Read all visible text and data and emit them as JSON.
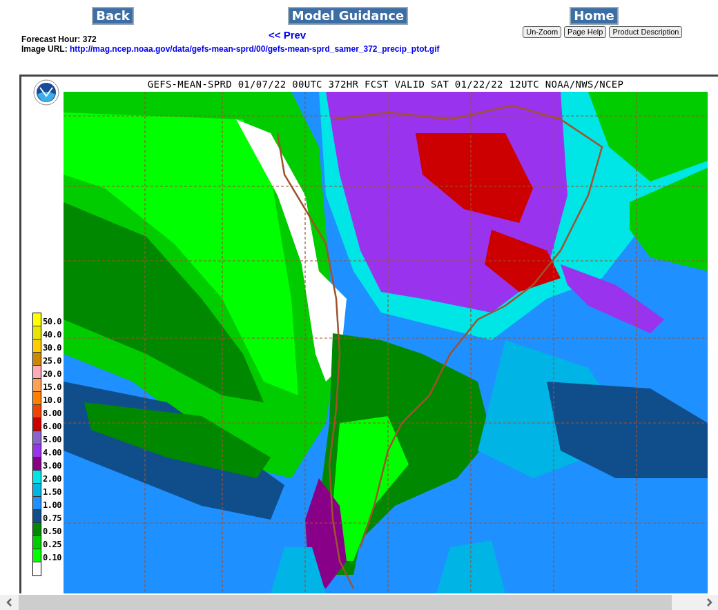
{
  "nav_buttons": [
    "Back",
    "Model Guidance",
    "Home"
  ],
  "prev_link": "<< Prev",
  "tool_buttons": [
    "Un-Zoom",
    "Page Help",
    "Product Description"
  ],
  "forecast_hour": {
    "label": "Forecast Hour:",
    "value": "372"
  },
  "image_url": {
    "label": "Image URL:",
    "value": "http://mag.ncep.noaa.gov/data/gefs-mean-sprd/00/gefs-mean-sprd_samer_372_precip_ptot.gif"
  },
  "map": {
    "title": "GEFS-MEAN-SPRD 01/07/22 00UTC 372HR FCST VALID SAT 01/22/22 12UTC NOAA/NWS/NCEP",
    "legend": [
      {
        "label": "50.0",
        "color": "#ffff00"
      },
      {
        "label": "40.0",
        "color": "#e6e600"
      },
      {
        "label": "30.0",
        "color": "#ffcc00"
      },
      {
        "label": "25.0",
        "color": "#cc8800"
      },
      {
        "label": "20.0",
        "color": "#ffaab4"
      },
      {
        "label": "15.0",
        "color": "#ffa050"
      },
      {
        "label": "10.0",
        "color": "#ff7f00"
      },
      {
        "label": "8.00",
        "color": "#ee4400"
      },
      {
        "label": "6.00",
        "color": "#cc0000"
      },
      {
        "label": "5.00",
        "color": "#8866cc"
      },
      {
        "label": "4.00",
        "color": "#9933ee"
      },
      {
        "label": "3.00",
        "color": "#880088"
      },
      {
        "label": "2.00",
        "color": "#00e5e5"
      },
      {
        "label": "1.50",
        "color": "#00b4e6"
      },
      {
        "label": "1.00",
        "color": "#1e90ff"
      },
      {
        "label": "0.75",
        "color": "#104e8b"
      },
      {
        "label": "0.50",
        "color": "#008800"
      },
      {
        "label": "0.25",
        "color": "#00cc00"
      },
      {
        "label": "0.10",
        "color": "#00ff00"
      }
    ]
  }
}
